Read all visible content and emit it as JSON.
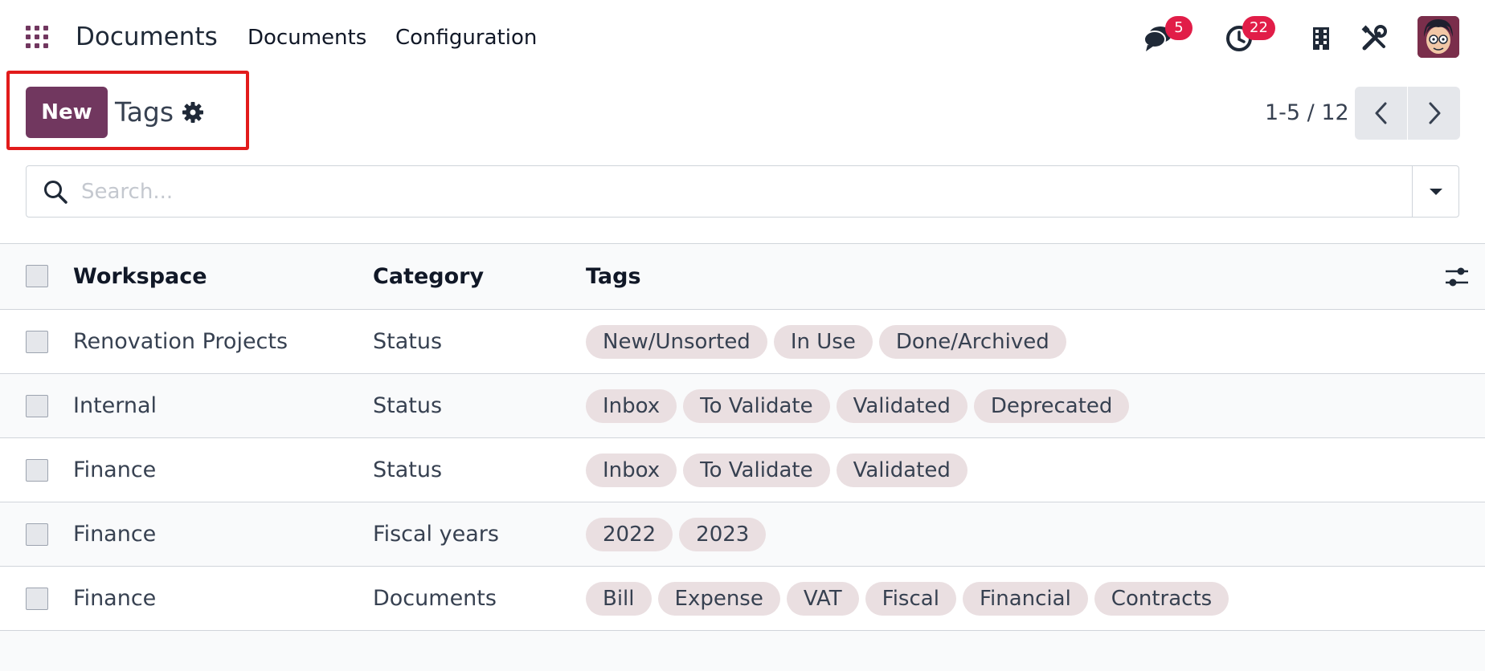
{
  "navbar": {
    "brand": "Documents",
    "menu": [
      "Documents",
      "Configuration"
    ],
    "messages_count": "5",
    "activities_count": "22",
    "icons": {
      "apps": "apps-grid-icon",
      "messages": "chat-icon",
      "activities": "clock-icon",
      "company": "building-icon",
      "debug": "tools-icon"
    }
  },
  "control": {
    "new_label": "New",
    "title": "Tags",
    "pager": "1-5 / 12"
  },
  "search": {
    "placeholder": "Search..."
  },
  "table": {
    "columns": [
      "Workspace",
      "Category",
      "Tags"
    ],
    "rows": [
      {
        "workspace": "Renovation Projects",
        "category": "Status",
        "tags": [
          "New/Unsorted",
          "In Use",
          "Done/Archived"
        ]
      },
      {
        "workspace": "Internal",
        "category": "Status",
        "tags": [
          "Inbox",
          "To Validate",
          "Validated",
          "Deprecated"
        ]
      },
      {
        "workspace": "Finance",
        "category": "Status",
        "tags": [
          "Inbox",
          "To Validate",
          "Validated"
        ]
      },
      {
        "workspace": "Finance",
        "category": "Fiscal years",
        "tags": [
          "2022",
          "2023"
        ]
      },
      {
        "workspace": "Finance",
        "category": "Documents",
        "tags": [
          "Bill",
          "Expense",
          "VAT",
          "Fiscal",
          "Financial",
          "Contracts"
        ]
      }
    ]
  },
  "colors": {
    "brand": "#71375f",
    "badge": "#e11d48",
    "tag_bg": "#eadfe1",
    "highlight": "#e21b1b"
  }
}
